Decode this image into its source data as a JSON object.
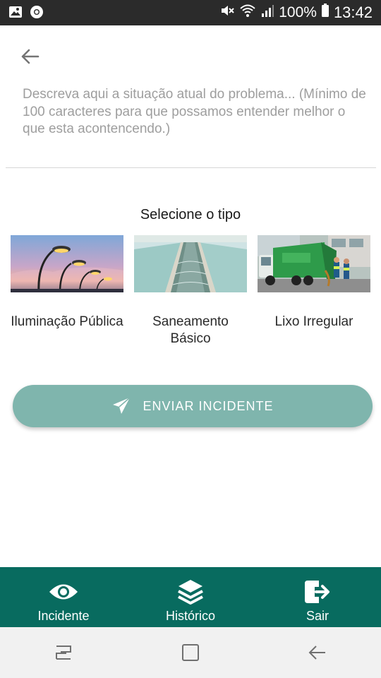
{
  "status_bar": {
    "battery": "100%",
    "time": "13:42",
    "left_icons": [
      "image-icon",
      "chrome-icon"
    ],
    "right_icons": [
      "mute-icon",
      "wifi-icon",
      "signal-icon",
      "battery-icon"
    ]
  },
  "description": {
    "placeholder": "Descreva aqui a situação atual do problema... (Mínimo de 100 caracteres para que possamos entender melhor o que esta acontencendo.)",
    "value": ""
  },
  "type_section": {
    "title": "Selecione o tipo",
    "options": [
      {
        "label": "Iluminação Pública",
        "icon": "street-light-photo"
      },
      {
        "label": "Saneamento Básico",
        "icon": "water-treatment-photo"
      },
      {
        "label": "Lixo Irregular",
        "icon": "garbage-truck-photo"
      }
    ]
  },
  "submit": {
    "label": "ENVIAR INCIDENTE",
    "icon": "send-icon"
  },
  "bottom_nav": {
    "items": [
      {
        "label": "Incidente",
        "icon": "eye-icon"
      },
      {
        "label": "Histórico",
        "icon": "layers-icon"
      },
      {
        "label": "Sair",
        "icon": "logout-icon"
      }
    ]
  },
  "colors": {
    "primary": "#086b5f",
    "button": "#7fb5ad",
    "status_bar": "#2b2b2b"
  }
}
